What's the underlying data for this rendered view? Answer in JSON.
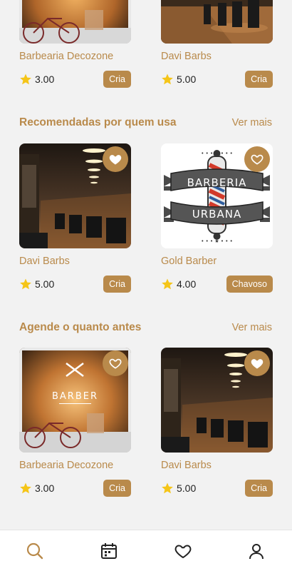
{
  "top_row": [
    {
      "name": "Barbearia Decozone",
      "rating": "3.00",
      "tag": "Cria",
      "image": "barber-shop-window"
    },
    {
      "name": "Davi Barbs",
      "rating": "5.00",
      "tag": "Cria",
      "image": "barber-shop-interior"
    }
  ],
  "sections": [
    {
      "title": "Recomendadas por quem usa",
      "see_more": "Ver mais",
      "cards": [
        {
          "name": "Davi Barbs",
          "rating": "5.00",
          "tag": "Cria",
          "image": "barber-shop-interior"
        },
        {
          "name": "Gold Barber",
          "rating": "4.00",
          "tag": "Chavoso",
          "image": "barberia-urbana-logo",
          "logo_text": [
            "BARBERIA",
            "URBANA"
          ]
        }
      ]
    },
    {
      "title": "Agende o quanto antes",
      "see_more": "Ver mais",
      "cards": [
        {
          "name": "Barbearia Decozone",
          "rating": "3.00",
          "tag": "Cria",
          "image": "barber-shop-window",
          "logo_text": [
            "BARBER"
          ]
        },
        {
          "name": "Davi Barbs",
          "rating": "5.00",
          "tag": "Cria",
          "image": "barber-shop-interior"
        }
      ]
    }
  ],
  "nav": [
    {
      "name": "search-icon",
      "active": true
    },
    {
      "name": "calendar-icon",
      "active": false
    },
    {
      "name": "heart-icon",
      "active": false
    },
    {
      "name": "user-icon",
      "active": false
    }
  ],
  "colors": {
    "accent": "#b98a4b",
    "star": "#f5c518",
    "background": "#f2f2f2",
    "tab_inactive": "#222222"
  }
}
